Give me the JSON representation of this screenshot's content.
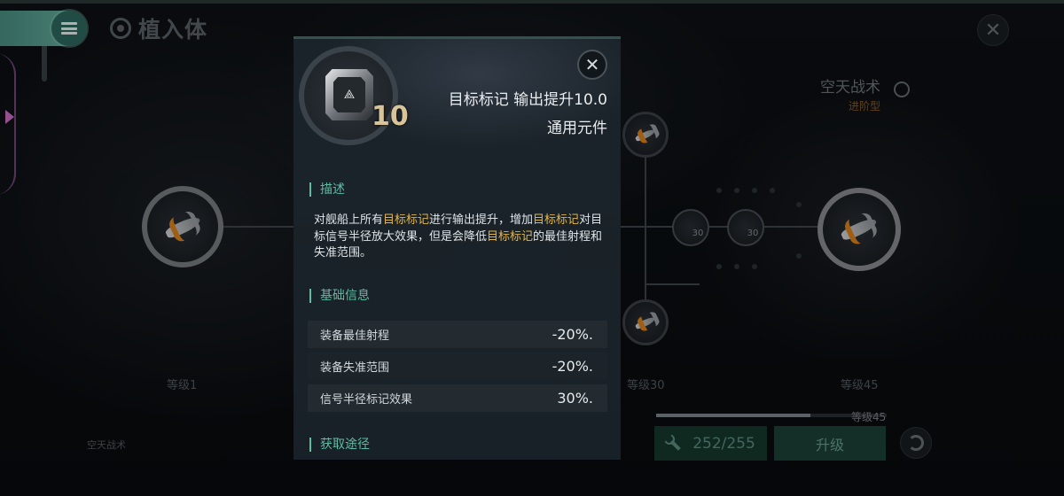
{
  "header": {
    "title": "植入体",
    "menu_icon": "menu-icon",
    "close_icon": "close-icon"
  },
  "tree": {
    "branch_name": "空天战术",
    "branch_tier": "进阶型",
    "nodes": [
      {
        "label": "等级1"
      },
      {
        "label": "等级30"
      },
      {
        "label": "等级45"
      }
    ],
    "small_node_values": [
      "30",
      "30"
    ],
    "bottom_left_label": "空天战术",
    "progress": {
      "label": "等级45",
      "fraction": 0.67
    },
    "cost_value": "252/255",
    "upgrade_label": "升级"
  },
  "modal": {
    "item_level": "10",
    "item_name": "目标标记 输出提升10.0",
    "item_type": "通用元件",
    "sections": {
      "description_title": "描述",
      "basic_info_title": "基础信息",
      "source_title": "获取途径"
    },
    "description": {
      "parts": [
        "对舰船上所有",
        "目标标记",
        "进行输出提升，增加",
        "目标标记",
        "对目标信号半径放大效果，但是会降低",
        "目标标记",
        "的最佳射程和失准范围。"
      ]
    },
    "stats": [
      {
        "label": "装备最佳射程",
        "value": "-20%."
      },
      {
        "label": "装备失准范围",
        "value": "-20%."
      },
      {
        "label": "信号半径标记效果",
        "value": "30%."
      }
    ],
    "colors": {
      "highlight": "#e2b54a",
      "section_accent": "#5fbca3"
    }
  }
}
